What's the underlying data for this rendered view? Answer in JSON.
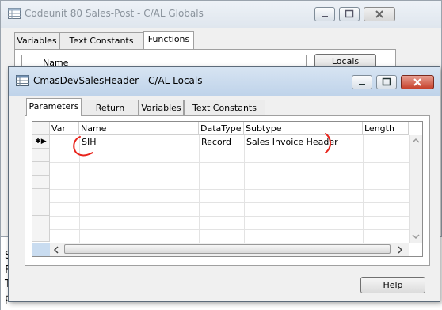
{
  "globals_window": {
    "title": "Codeunit 80 Sales-Post - C/AL Globals",
    "tabs": [
      {
        "label": "Variables"
      },
      {
        "label": "Text Constants"
      },
      {
        "label": "Functions"
      }
    ],
    "grid_header": {
      "name": "Name"
    },
    "locals_button": "Locals"
  },
  "locals_window": {
    "title": "CmasDevSalesHeader - C/AL Locals",
    "tabs": [
      {
        "label": "Parameters"
      },
      {
        "label": "Return Value"
      },
      {
        "label": "Variables"
      },
      {
        "label": "Text Constants"
      }
    ],
    "columns": {
      "var": "Var",
      "name": "Name",
      "datatype": "DataType",
      "subtype": "Subtype",
      "length": "Length"
    },
    "rows": [
      {
        "indicator": "✱▶",
        "var": "",
        "name": "SIH",
        "datatype": "Record",
        "subtype": "Sales Invoice Header",
        "length": ""
      }
    ],
    "help_button": "Help",
    "annotation_color": "#e8231b"
  },
  "background_text_fragments": [
    "S",
    "F",
    "T",
    "p"
  ]
}
